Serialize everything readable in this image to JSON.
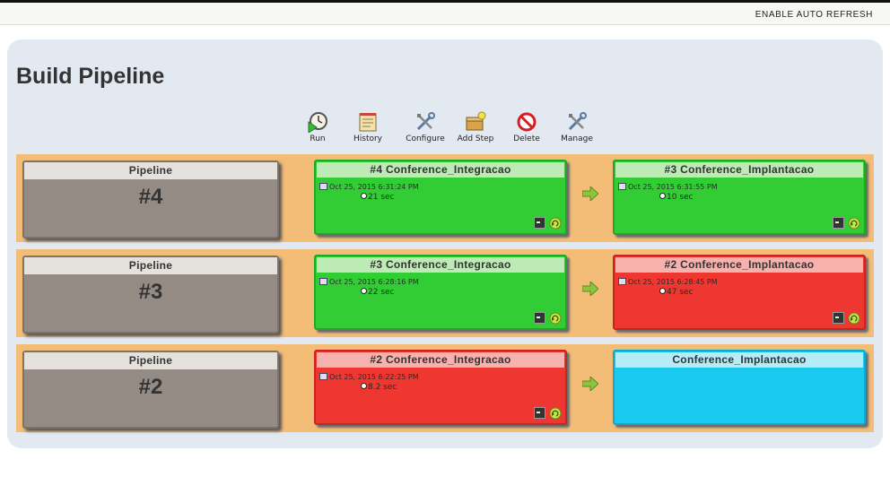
{
  "header": {
    "auto_refresh": "ENABLE AUTO REFRESH"
  },
  "page": {
    "title": "Build Pipeline"
  },
  "toolbar": {
    "run": "Run",
    "history": "History",
    "configure": "Configure",
    "add_step": "Add Step",
    "delete": "Delete",
    "manage": "Manage"
  },
  "rows": [
    {
      "pipeline": {
        "label": "Pipeline",
        "number": "#4"
      },
      "build1": {
        "name": "#4 Conference_Integracao",
        "date": "Oct 25, 2015 6:31:24 PM",
        "duration": "21 sec",
        "status": "success"
      },
      "build2": {
        "name": "#3 Conference_Implantacao",
        "date": "Oct 25, 2015 6:31:55 PM",
        "duration": "10 sec",
        "status": "success"
      }
    },
    {
      "pipeline": {
        "label": "Pipeline",
        "number": "#3"
      },
      "build1": {
        "name": "#3 Conference_Integracao",
        "date": "Oct 25, 2015 6:28:16 PM",
        "duration": "22 sec",
        "status": "success"
      },
      "build2": {
        "name": "#2 Conference_Implantacao",
        "date": "Oct 25, 2015 6:28:45 PM",
        "duration": "47 sec",
        "status": "failure"
      }
    },
    {
      "pipeline": {
        "label": "Pipeline",
        "number": "#2"
      },
      "build1": {
        "name": "#2 Conference_Integracao",
        "date": "Oct 25, 2015 6:22:25 PM",
        "duration": "8.2 sec",
        "status": "failure"
      },
      "build2": {
        "name": "Conference_Implantacao",
        "status": "pending"
      }
    }
  ],
  "colors": {
    "success": "#32cd35",
    "failure": "#ee3730",
    "pending": "#19c9ee",
    "pipeline_row": "#f3bd77",
    "pipeline_card": "#948b85"
  },
  "icons": {
    "run": "clock-play-icon",
    "history": "notepad-icon",
    "configure": "tools-icon",
    "add_step": "box-add-icon",
    "delete": "no-entry-icon",
    "manage": "tools-icon",
    "console": "terminal-icon",
    "rerun": "rerun-icon",
    "arrow": "green-arrow-right-icon"
  }
}
